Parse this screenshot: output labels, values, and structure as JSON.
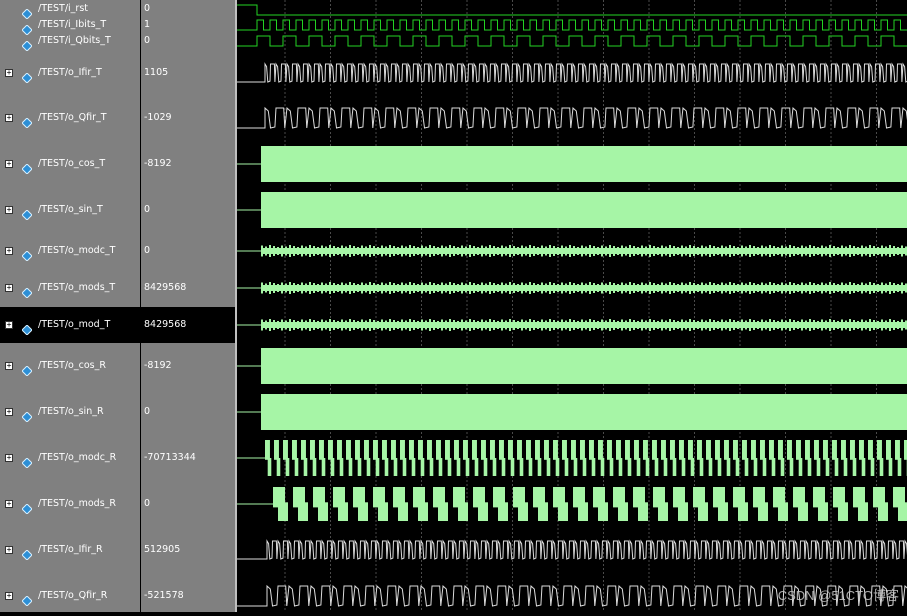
{
  "signals": [
    {
      "name": "/TEST/i_rst",
      "value": "0",
      "expandable": false,
      "selected": false
    },
    {
      "name": "/TEST/i_Ibits_T",
      "value": "1",
      "expandable": false,
      "selected": false
    },
    {
      "name": "/TEST/i_Qbits_T",
      "value": "0",
      "expandable": false,
      "selected": false
    },
    {
      "name": "/TEST/o_Ifir_T",
      "value": "1105",
      "expandable": true,
      "selected": false
    },
    {
      "name": "/TEST/o_Qfir_T",
      "value": "-1029",
      "expandable": true,
      "selected": false
    },
    {
      "name": "/TEST/o_cos_T",
      "value": "-8192",
      "expandable": true,
      "selected": false
    },
    {
      "name": "/TEST/o_sin_T",
      "value": "0",
      "expandable": true,
      "selected": false
    },
    {
      "name": "/TEST/o_modc_T",
      "value": "0",
      "expandable": true,
      "selected": false
    },
    {
      "name": "/TEST/o_mods_T",
      "value": "8429568",
      "expandable": true,
      "selected": false
    },
    {
      "name": "/TEST/o_mod_T",
      "value": "8429568",
      "expandable": true,
      "selected": true
    },
    {
      "name": "/TEST/o_cos_R",
      "value": "-8192",
      "expandable": true,
      "selected": false
    },
    {
      "name": "/TEST/o_sin_R",
      "value": "0",
      "expandable": true,
      "selected": false
    },
    {
      "name": "/TEST/o_modc_R",
      "value": "-70713344",
      "expandable": true,
      "selected": false
    },
    {
      "name": "/TEST/o_mods_R",
      "value": "0",
      "expandable": true,
      "selected": false
    },
    {
      "name": "/TEST/o_Ifir_R",
      "value": "512905",
      "expandable": true,
      "selected": false
    },
    {
      "name": "/TEST/o_Qfir_R",
      "value": "-521578",
      "expandable": true,
      "selected": false
    }
  ],
  "colors": {
    "wave": "#23d323",
    "analog": "#a6f5a6",
    "grid": "#4a4a4a",
    "panel": "#808080",
    "text": "#ffffff"
  },
  "icons": {
    "expander": "plus-box-icon",
    "signal": "diamond-signal-icon"
  },
  "expander_glyph": "+",
  "watermark": "CSDN @51CTO博客"
}
